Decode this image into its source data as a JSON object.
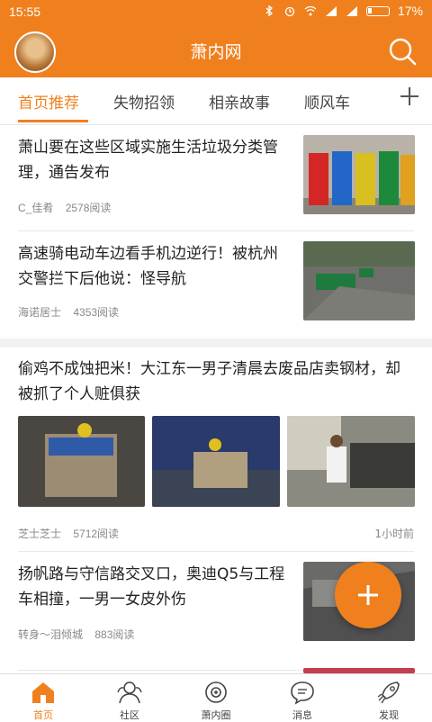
{
  "status_bar": {
    "time": "15:55",
    "battery": "17%"
  },
  "header": {
    "title": "萧内网"
  },
  "tabs": [
    {
      "label": "首页推荐",
      "active": true
    },
    {
      "label": "失物招领",
      "active": false
    },
    {
      "label": "相亲故事",
      "active": false
    },
    {
      "label": "顺风车",
      "active": false
    }
  ],
  "articles": [
    {
      "title": "萧山要在这些区域实施生活垃圾分类管理，通告发布",
      "author": "C_佳肴",
      "reads": "2578阅读"
    },
    {
      "title": "高速骑电动车边看手机边逆行！被杭州交警拦下后他说：怪导航",
      "author": "海诺居士",
      "reads": "4353阅读"
    },
    {
      "title": "偷鸡不成蚀把米！大江东一男子清晨去废品店卖钢材，却被抓了个人赃俱获",
      "author": "芝士芝士",
      "reads": "5712阅读",
      "time": "1小时前"
    },
    {
      "title": "扬帆路与守信路交叉口，奥迪Q5与工程车相撞，一男一女皮外伤",
      "author": "转身～泪倾城",
      "reads": "883阅读"
    }
  ],
  "fab": {
    "label": "+"
  },
  "bottom_nav": [
    {
      "label": "首页",
      "icon": "home-icon",
      "active": true
    },
    {
      "label": "社区",
      "icon": "community-icon",
      "active": false
    },
    {
      "label": "萧内圈",
      "icon": "circle-icon",
      "active": false
    },
    {
      "label": "消息",
      "icon": "message-icon",
      "active": false
    },
    {
      "label": "发现",
      "icon": "rocket-icon",
      "active": false
    }
  ],
  "colors": {
    "accent": "#f0801e"
  }
}
